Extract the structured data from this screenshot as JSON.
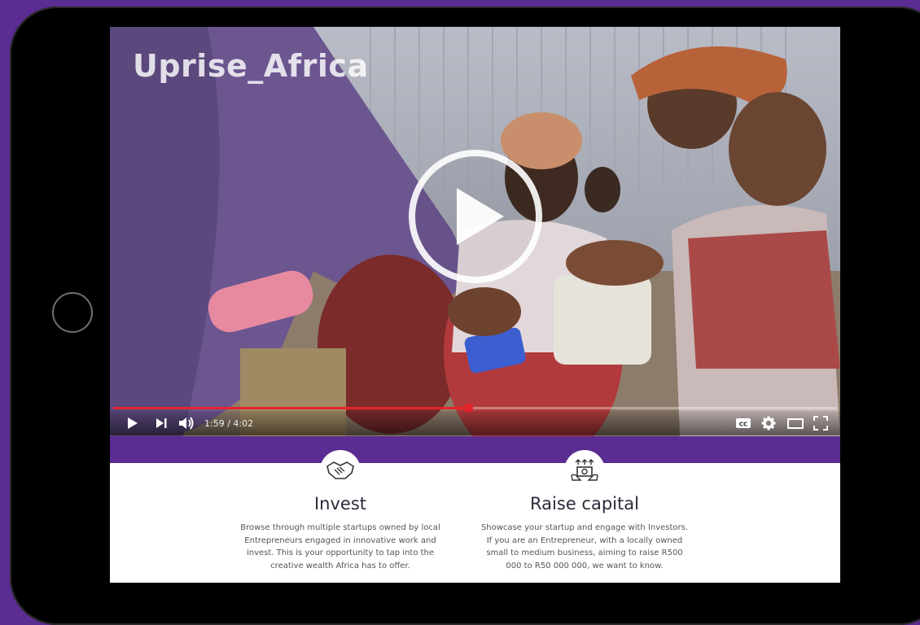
{
  "brand": {
    "logo_text": "Uprise_Africa",
    "accent_color": "#5b2c91"
  },
  "video": {
    "progress_fraction": 0.49,
    "time_display": "1:59 / 4:02",
    "controls": [
      "play-icon",
      "next-icon",
      "volume-icon",
      "cc-icon",
      "gear-icon",
      "theater-icon",
      "fullscreen-icon"
    ]
  },
  "features": [
    {
      "icon": "handshake-icon",
      "title": "Invest",
      "text": "Browse through multiple startups owned by local Entrepreneurs engaged in innovative work and invest. This is your opportunity to tap into the creative wealth Africa has to offer."
    },
    {
      "icon": "raise-money-icon",
      "title": "Raise capital",
      "text": "Showcase your startup and engage with Investors. If you are an Entrepreneur, with a locally owned small to medium business, aiming to raise R500 000 to R50 000 000, we want to know."
    }
  ]
}
